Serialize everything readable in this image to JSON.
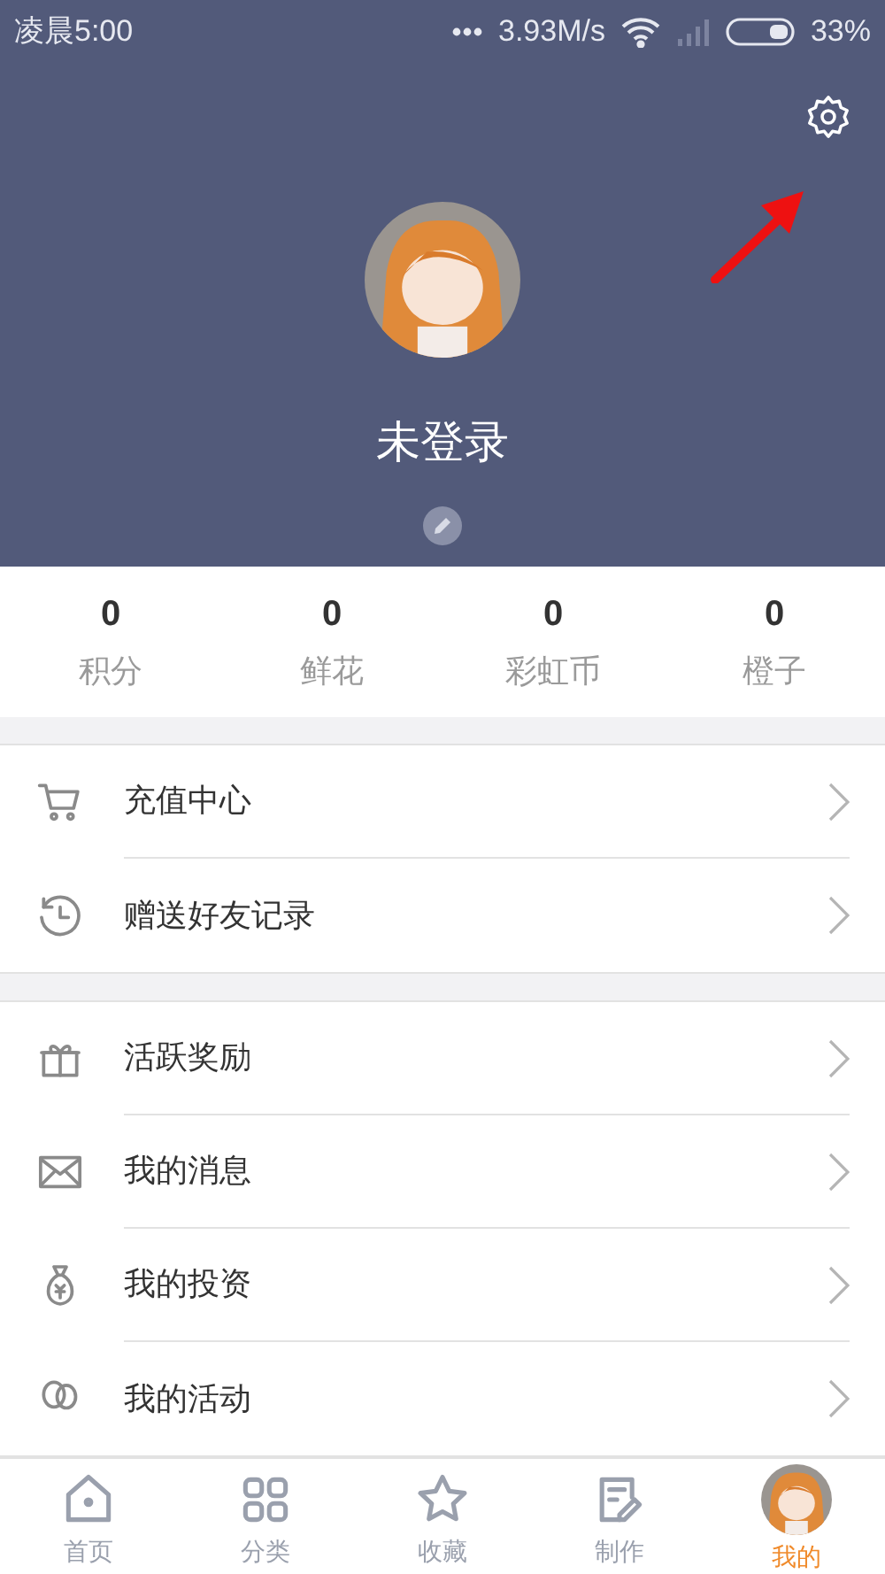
{
  "status_bar": {
    "time": "凌晨5:00",
    "speed": "3.93M/s",
    "battery": "33%"
  },
  "profile": {
    "name": "未登录"
  },
  "stats": [
    {
      "value": "0",
      "label": "积分"
    },
    {
      "value": "0",
      "label": "鲜花"
    },
    {
      "value": "0",
      "label": "彩虹币"
    },
    {
      "value": "0",
      "label": "橙子"
    }
  ],
  "menu_groups": [
    [
      {
        "kind": "cart",
        "label": "充值中心"
      },
      {
        "kind": "history",
        "label": "赠送好友记录"
      }
    ],
    [
      {
        "kind": "gift",
        "label": "活跃奖励"
      },
      {
        "kind": "mail",
        "label": "我的消息"
      },
      {
        "kind": "moneybag",
        "label": "我的投资"
      },
      {
        "kind": "activity",
        "label": "我的活动"
      }
    ]
  ],
  "tabs": [
    {
      "kind": "home",
      "label": "首页",
      "selected": false
    },
    {
      "kind": "grid",
      "label": "分类",
      "selected": false
    },
    {
      "kind": "star",
      "label": "收藏",
      "selected": false
    },
    {
      "kind": "edit",
      "label": "制作",
      "selected": false
    },
    {
      "kind": "avatar",
      "label": "我的",
      "selected": true
    }
  ]
}
